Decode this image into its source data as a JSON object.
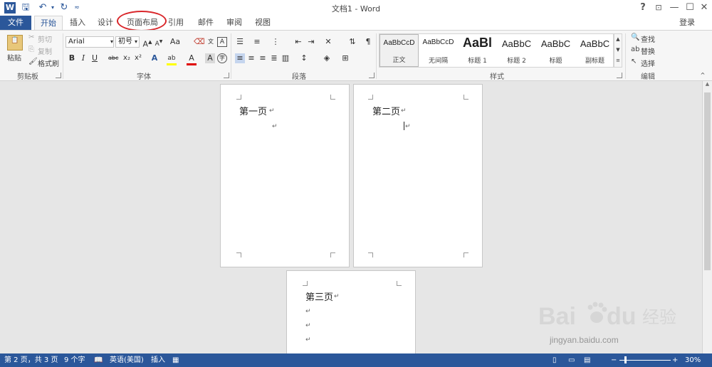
{
  "window": {
    "title": "文档1 - Word",
    "help": "?",
    "controls": [
      "□",
      "—",
      "□",
      "✕"
    ]
  },
  "tabs": {
    "file": "文件",
    "items": [
      "开始",
      "插入",
      "设计",
      "页面布局",
      "引用",
      "邮件",
      "审阅",
      "视图"
    ],
    "active": "开始",
    "login": "登录"
  },
  "clipboard": {
    "paste": "粘贴",
    "cut": "剪切",
    "copy": "复制",
    "format_painter": "格式刷",
    "label": "剪贴板"
  },
  "font": {
    "name": "Arial",
    "size": "初号",
    "label": "字体",
    "case_button": "Aa"
  },
  "paragraph": {
    "label": "段落"
  },
  "styles": {
    "label": "样式",
    "items": [
      {
        "preview": "AaBbCcD",
        "name": "正文"
      },
      {
        "preview": "AaBbCcD",
        "name": "无间隔"
      },
      {
        "preview": "AaBl",
        "name": "标题 1"
      },
      {
        "preview": "AaBbC",
        "name": "标题 2"
      },
      {
        "preview": "AaBbC",
        "name": "标题"
      },
      {
        "preview": "AaBbC",
        "name": "副标题"
      }
    ]
  },
  "editing": {
    "find": "查找",
    "replace": "替换",
    "select": "选择",
    "label": "编辑"
  },
  "document": {
    "pages": [
      {
        "text": "第一页",
        "mark": "↵"
      },
      {
        "text": "第二页",
        "mark": "↵"
      },
      {
        "text": "第三页",
        "mark": "↵"
      }
    ]
  },
  "status": {
    "page": "第 2 页，共 3 页",
    "words": "9 个字",
    "language": "英语(美国)",
    "mode": "插入",
    "zoom": "30%"
  },
  "watermark": {
    "brand": "Bai",
    "brand2": "du",
    "cn": "经验",
    "url": "jingyan.baidu.com"
  }
}
